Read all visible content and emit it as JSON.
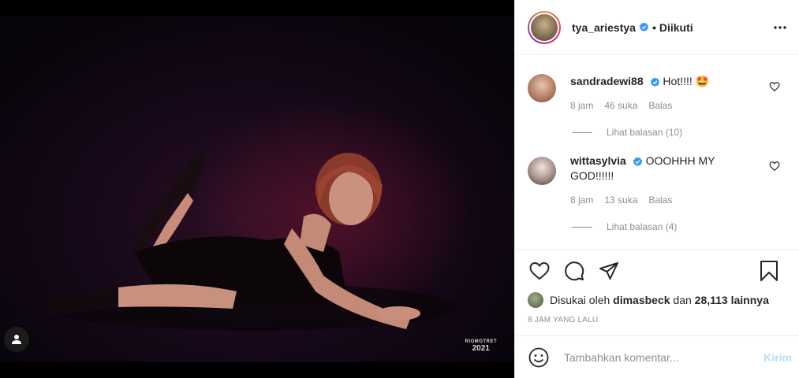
{
  "post": {
    "watermark_top": "RIOMOTRET",
    "watermark_year": "2021"
  },
  "header": {
    "username": "tya_ariestya",
    "separator": "•",
    "follow_status": "Diikuti"
  },
  "comments": [
    {
      "username": "sandradewi88",
      "text": "Hot!!!! 🤩",
      "time": "8 jam",
      "likes": "46 suka",
      "reply_label": "Balas",
      "view_replies": "Lihat balasan (10)"
    },
    {
      "username": "wittasylvia",
      "text": "OOOHHH MY GOD!!!!!!",
      "time": "8 jam",
      "likes": "13 suka",
      "reply_label": "Balas",
      "view_replies": "Lihat balasan (4)"
    }
  ],
  "likes": {
    "prefix": "Disukai oleh",
    "user": "dimasbeck",
    "conj": "dan",
    "count": "28,113 lainnya"
  },
  "timestamp": "8 JAM YANG LALU",
  "add_comment": {
    "placeholder": "Tambahkan komentar...",
    "post_label": "Kirim"
  },
  "colors": {
    "verified": "#3897f0",
    "post_button": "#b2dffc",
    "muted": "#8e8e8e"
  }
}
